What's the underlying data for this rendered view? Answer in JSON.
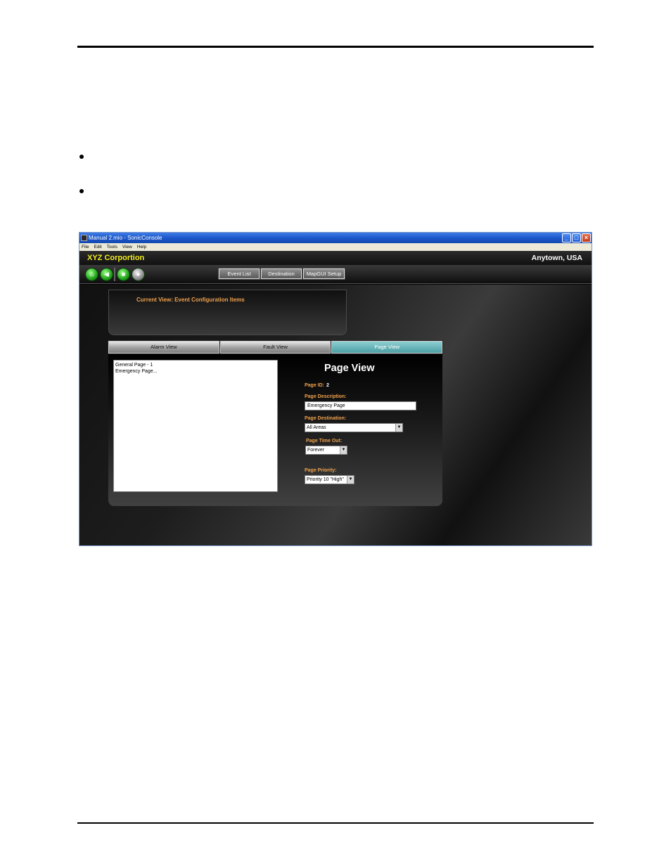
{
  "window": {
    "title": "Manual 2.mio - SonicConsole",
    "min_label": "_",
    "max_label": "□",
    "close_label": "×"
  },
  "menu": [
    "File",
    "Edit",
    "Tools",
    "View",
    "Help"
  ],
  "header": {
    "company": "XYZ Corportion",
    "location": "Anytown, USA"
  },
  "toolbar": {
    "icons": [
      "home-icon",
      "back-icon",
      "stop-icon",
      "disabled-icon"
    ],
    "nav_tabs": [
      "Event List",
      "Destination",
      "MapGUI Setup"
    ]
  },
  "current_view": "Current View: Event Configuration Items",
  "view_tabs": {
    "alarm": "Alarm View",
    "fault": "Fault View",
    "page": "Page View"
  },
  "list": {
    "items": [
      "General Page - 1",
      "Emergency Page..."
    ]
  },
  "page_view": {
    "title": "Page View",
    "page_id_label": "Page ID:",
    "page_id_value": "2",
    "description_label": "Page Description:",
    "description_value": "Emergency Page",
    "destination_label": "Page Destination:",
    "destination_value": "All Areas",
    "timeout_label": "Page Time Out:",
    "timeout_value": "Forever",
    "priority_label": "Page Priority:",
    "priority_value": "Priority 10 \"High\""
  },
  "colors": {
    "accent_orange": "#f0a14e",
    "company_yellow": "#f2ec1e",
    "active_tab_teal": "#5fb1b5"
  }
}
